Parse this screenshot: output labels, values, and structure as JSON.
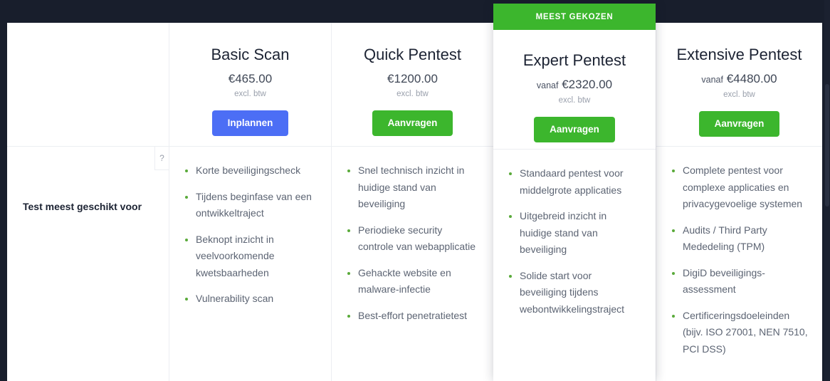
{
  "background_color": "#181e2c",
  "accent_blue": "#4c6ef5",
  "accent_green": "#3cb62d",
  "bullet_color": "#5aaa3a",
  "ribbon": {
    "label": "MEEST GEKOZEN"
  },
  "row": {
    "label": "Test meest geschikt voor",
    "help_icon": "question-mark-icon",
    "help_label": "?"
  },
  "vat_note": "excl. btw",
  "price_prefix": "vanaf",
  "plans": [
    {
      "title": "Basic Scan",
      "price": "€465.00",
      "price_prefix": "",
      "vat": "excl. btw",
      "cta": "Inplannen",
      "cta_style": "blue",
      "featured": false,
      "features": [
        "Korte beveiligingscheck",
        "Tijdens beginfase van een ontwikkeltraject",
        "Beknopt inzicht in veelvoorkomende kwetsbaarheden",
        "Vulnerability scan"
      ]
    },
    {
      "title": "Quick Pentest",
      "price": "€1200.00",
      "price_prefix": "",
      "vat": "excl. btw",
      "cta": "Aanvragen",
      "cta_style": "green",
      "featured": false,
      "features": [
        "Snel technisch inzicht in huidige stand van beveiliging",
        "Periodieke security controle van webapplicatie",
        "Gehackte website en malware-infectie",
        "Best-effort penetratietest"
      ]
    },
    {
      "title": "Expert Pentest",
      "price": "€2320.00",
      "price_prefix": "vanaf",
      "vat": "excl. btw",
      "cta": "Aanvragen",
      "cta_style": "green",
      "featured": true,
      "features": [
        "Standaard pentest voor middelgrote applicaties",
        "Uitgebreid inzicht in huidige stand van beveiliging",
        "Solide start voor beveiliging tijdens webontwikkelingstraject"
      ]
    },
    {
      "title": "Extensive Pentest",
      "price": "€4480.00",
      "price_prefix": "vanaf",
      "vat": "excl. btw",
      "cta": "Aanvragen",
      "cta_style": "green",
      "featured": false,
      "features": [
        "Complete pentest voor complexe applicaties en privacygevoelige systemen",
        "Audits / Third Party Mededeling (TPM)",
        "DigiD beveiligings-assessment",
        "Certificeringsdoeleinden (bijv. ISO 27001, NEN 7510, PCI DSS)"
      ]
    }
  ]
}
